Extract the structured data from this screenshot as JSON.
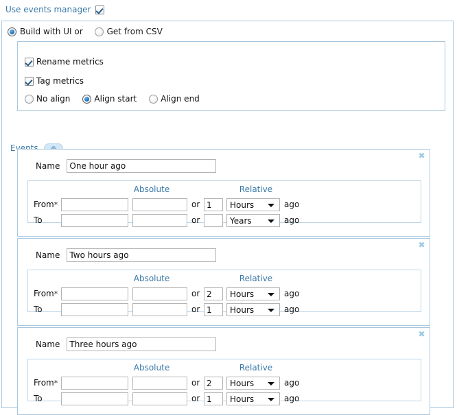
{
  "header": {
    "use_events_manager_label": "Use events manager",
    "use_events_manager_checked": true
  },
  "mode": {
    "build_with_ui_label": "Build with UI or",
    "get_from_csv_label": "Get from CSV",
    "selected": "build_with_ui"
  },
  "options": {
    "rename_metrics_label": "Rename metrics",
    "rename_metrics_checked": true,
    "tag_metrics_label": "Tag metrics",
    "tag_metrics_checked": true,
    "align_options": [
      {
        "label": "No align",
        "selected": false
      },
      {
        "label": "Align start",
        "selected": true
      },
      {
        "label": "Align end",
        "selected": false
      }
    ]
  },
  "events_section": {
    "title": "Events",
    "add_button_label": "+"
  },
  "labels": {
    "name": "Name",
    "absolute": "Absolute",
    "relative": "Relative",
    "from": "From",
    "from_required_marker": "*",
    "to": "To",
    "or": "or",
    "ago": "ago",
    "close": "✖"
  },
  "accent_colors": {
    "link_blue": "#3a79a8",
    "panel_border": "#a9c7de",
    "inner_border": "#bcd5e8",
    "close_icon": "#9cc8e6",
    "add_button_bg": "#d3e7f5"
  },
  "events": [
    {
      "name_value": "One hour ago",
      "from": {
        "absolute_date": "",
        "absolute_time": "",
        "relative_value": "1",
        "relative_unit": "Hours"
      },
      "to": {
        "absolute_date": "",
        "absolute_time": "",
        "relative_value": "",
        "relative_unit": "Years"
      }
    },
    {
      "name_value": "Two hours ago",
      "from": {
        "absolute_date": "",
        "absolute_time": "",
        "relative_value": "2",
        "relative_unit": "Hours"
      },
      "to": {
        "absolute_date": "",
        "absolute_time": "",
        "relative_value": "1",
        "relative_unit": "Hours"
      }
    },
    {
      "name_value": "Three hours ago",
      "from": {
        "absolute_date": "",
        "absolute_time": "",
        "relative_value": "2",
        "relative_unit": "Hours"
      },
      "to": {
        "absolute_date": "",
        "absolute_time": "",
        "relative_value": "1",
        "relative_unit": "Hours"
      }
    }
  ]
}
